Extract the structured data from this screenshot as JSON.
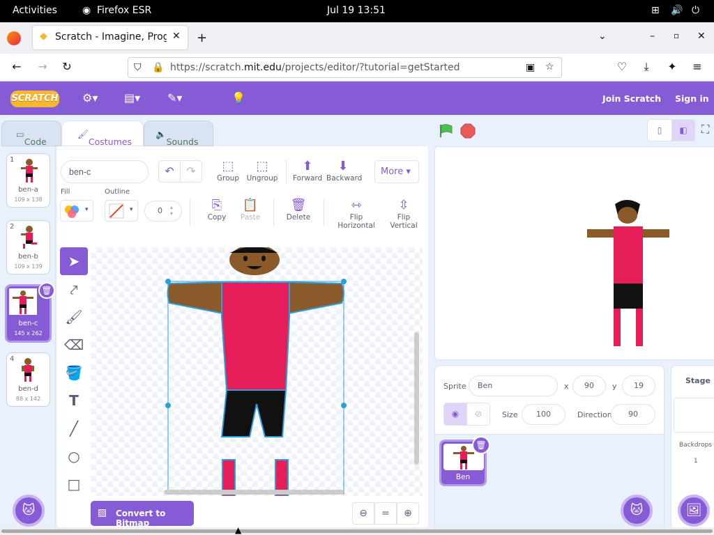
{
  "system": {
    "activities": "Activities",
    "app": "Firefox ESR",
    "clock": "Jul 19  13:51"
  },
  "browser": {
    "tab_title": "Scratch - Imagine, Progra",
    "url_prefix": "https://scratch.",
    "url_domain": "mit.edu",
    "url_suffix": "/projects/editor/?tutorial=getStarted"
  },
  "scratch_menu": {
    "logo": "SCRATCH",
    "join": "Join Scratch",
    "signin": "Sign in"
  },
  "tabs": {
    "code": "Code",
    "costumes": "Costumes",
    "sounds": "Sounds"
  },
  "costumes": [
    {
      "num": "1",
      "name": "ben-a",
      "size": "109 x 138"
    },
    {
      "num": "2",
      "name": "ben-b",
      "size": "109 x 139"
    },
    {
      "num": "3",
      "name": "ben-c",
      "size": "145 x 262"
    },
    {
      "num": "4",
      "name": "ben-d",
      "size": "88 x 142"
    }
  ],
  "paint": {
    "costume_name": "ben-c",
    "group": "Group",
    "ungroup": "Ungroup",
    "forward": "Forward",
    "backward": "Backward",
    "more": "More",
    "fill": "Fill",
    "outline": "Outline",
    "outline_width": "0",
    "copy": "Copy",
    "paste": "Paste",
    "delete": "Delete",
    "flip_h": "Flip Horizontal",
    "flip_v": "Flip Vertical",
    "convert": "Convert to Bitmap"
  },
  "sprite": {
    "label": "Sprite",
    "name": "Ben",
    "x_label": "x",
    "x": "90",
    "y_label": "y",
    "y": "19",
    "size_label": "Size",
    "size": "100",
    "dir_label": "Direction",
    "direction": "90",
    "tile_name": "Ben"
  },
  "stage_panel": {
    "title": "Stage",
    "backdrops_label": "Backdrops",
    "backdrops": "1"
  },
  "colors": {
    "accent": "#855cd6",
    "flag": "#4cbf56",
    "stop": "#ec5959"
  }
}
